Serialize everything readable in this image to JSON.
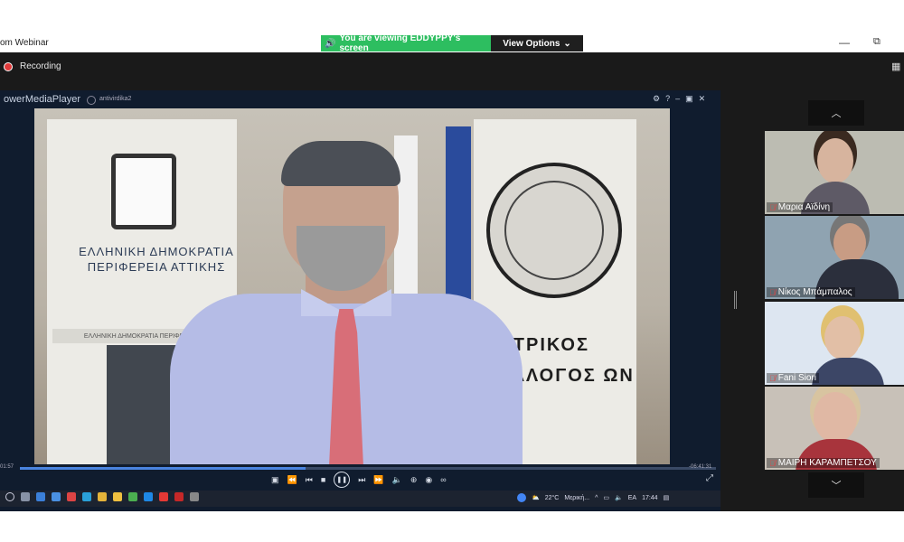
{
  "window": {
    "app_title": "om Webinar",
    "share_banner": "You are viewing EDDYPPY's screen",
    "view_options": "View Options",
    "minimize_glyph": "—",
    "maximize_glyph": "⧉"
  },
  "meeting": {
    "recording_label": "Recording"
  },
  "player": {
    "app_name": "owerMediaPlayer",
    "file_name": "antivirdika2",
    "time_elapsed": "01:57",
    "time_remaining": "-06:41:31",
    "progress": 0.41
  },
  "video_scene": {
    "left_banner_text": "ΕΛΛΗΝΙΚΗ ΔΗΜΟΚΡΑΤΙΑ ΠΕΡΙΦΕΡΕΙΑ ΑΤΤΙΚΗΣ",
    "left_strip_text": "ΕΛΛΗΝΙΚΗ ΔΗΜΟΚΡΑΤΙΑ ΠΕΡΙΦΕΡΕΙΑ ΑΤΤ",
    "right_banner_text": "ΑΤΡΙΚΟΣ ΥΛΛΟΓΟΣ ΩΝ"
  },
  "taskbar": {
    "temperature": "22°C",
    "weather_text": "Μερική...",
    "language": "EA",
    "clock": "17:44"
  },
  "participants": [
    {
      "name": "Μαρια Αϊδίνη",
      "muted": true,
      "bg": "#bcbcb2",
      "skin": "#d7b49e",
      "hair": "#3a2a20",
      "shirt": "#5e5a66"
    },
    {
      "name": "Νίκος Μπάμπαλος",
      "muted": true,
      "bg": "#8fa3b1",
      "skin": "#c89c84",
      "hair": "#777777",
      "shirt": "#2b2f3c"
    },
    {
      "name": "Fani Siori",
      "muted": true,
      "bg": "#dde6f1",
      "skin": "#e2bfa6",
      "hair": "#e0c070",
      "shirt": "#3c4666"
    },
    {
      "name": "ΜΑΙΡΗ ΚΑΡΑΜΠΕΤΣΟΥ",
      "muted": true,
      "bg": "#c8c1b8",
      "skin": "#e0b8a4",
      "hair": "#d8c4a0",
      "shirt": "#a8343c"
    }
  ]
}
